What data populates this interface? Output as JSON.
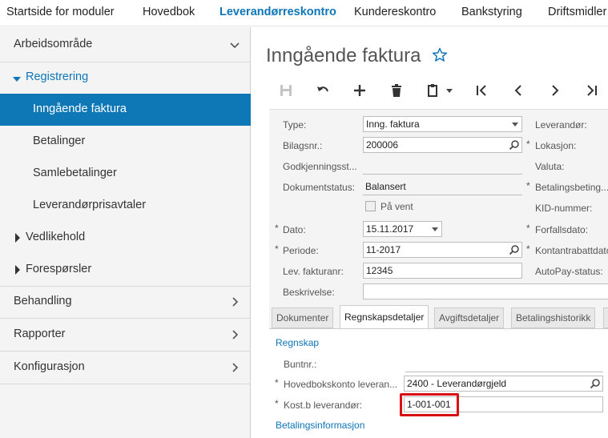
{
  "topnav": {
    "tabs": [
      {
        "label": "Startside for moduler"
      },
      {
        "label": "Hovedbok"
      },
      {
        "label": "Leverandørreskontro"
      },
      {
        "label": "Kundereskontro"
      },
      {
        "label": "Bankstyring"
      },
      {
        "label": "Driftsmidler"
      }
    ],
    "active_index": 2
  },
  "sidebar": {
    "workspace": "Arbeidsområde",
    "registrering": "Registrering",
    "items": [
      "Inngående faktura",
      "Betalinger",
      "Samlebetalinger",
      "Leverandørprisavtaler"
    ],
    "vedlikehold": "Vedlikehold",
    "foresporsler": "Forespørsler",
    "behandling": "Behandling",
    "rapporter": "Rapporter",
    "konfigurasjon": "Konfigurasjon"
  },
  "page": {
    "title": "Inngående faktura"
  },
  "form": {
    "type_label": "Type:",
    "type_value": "Inng. faktura",
    "bilagsnr_label": "Bilagsnr.:",
    "bilagsnr_value": "200006",
    "godkjenning_label": "Godkjenningsst...",
    "dokumentstatus_label": "Dokumentstatus:",
    "dokumentstatus_value": "Balansert",
    "paa_vent_label": "På vent",
    "dato_label": "Dato:",
    "dato_value": "15.11.2017",
    "periode_label": "Periode:",
    "periode_value": "11-2017",
    "lev_fakturanr_label": "Lev. fakturanr:",
    "lev_fakturanr_value": "12345",
    "beskrivelse_label": "Beskrivelse:",
    "leverandor_label": "Leverandør:",
    "lokasjon_label": "Lokasjon:",
    "valuta_label": "Valuta:",
    "betalingsbeting_label": "Betalingsbeting...",
    "kid_label": "KID-nummer:",
    "forfallsdato_label": "Forfallsdato:",
    "kontantrabatt_label": "Kontantrabattdato",
    "autopay_label": "AutoPay-status:",
    "required_mark": "*"
  },
  "tabs": [
    "Dokumenter",
    "Regnskapsdetaljer",
    "Avgiftsdetaljer",
    "Betalingshistorikk"
  ],
  "details": {
    "regnskap_header": "Regnskap",
    "buntnr_label": "Buntnr.:",
    "hovedbok_label": "Hovedbokskonto leveran...",
    "hovedbok_value": "2400 - Leverandørgjeld",
    "kostb_label": "Kost.b leverandør:",
    "kostb_value": "1-001-001",
    "betalingsinfo_header": "Betalingsinformasjon"
  }
}
